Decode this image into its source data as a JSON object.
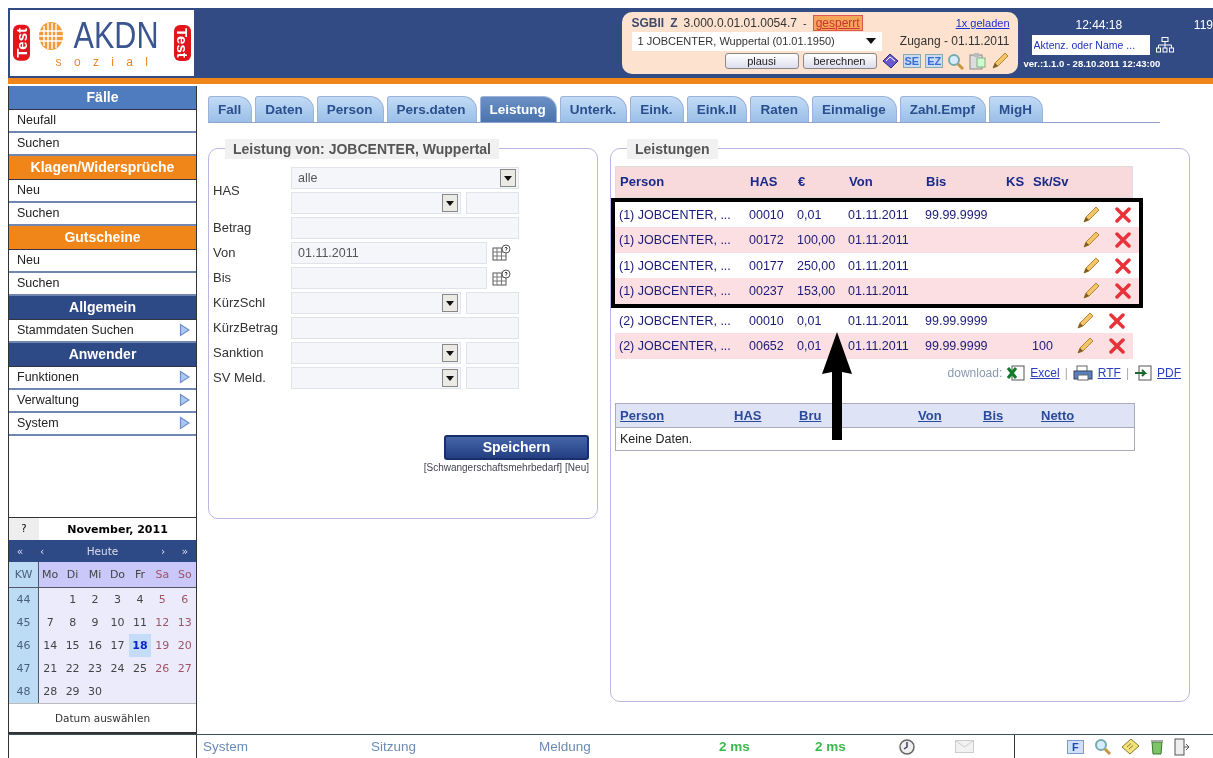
{
  "header": {
    "logo": {
      "badge_left": "Test",
      "brand": "AKDN",
      "subtitle": "s o z i a l",
      "badge_right": "Test"
    },
    "case": {
      "program": "SGBII",
      "mode": "Z",
      "version": "3.000.0.01.01.0054.7",
      "dash": "-",
      "lock_status": "gesperrt",
      "loaded": "1x geladen",
      "person_select": "1 JOBCENTER, Wuppertal (01.01.1950)",
      "access": "Zugang - 01.11.2011",
      "buttons": [
        "plausi",
        "berechnen"
      ],
      "badges": [
        "SE",
        "EZ"
      ]
    },
    "clock": "12:44:18",
    "counter": "119",
    "search": {
      "placeholder": "Aktenz. oder Name ..."
    },
    "version": "ver.:1.1.0 - 28.10.2011 12:43:00"
  },
  "sidebar": {
    "items": [
      {
        "kind": "header",
        "label": "Fälle",
        "color": "#4f7cbf"
      },
      {
        "kind": "item",
        "label": "Neufall",
        "has_submenu": false
      },
      {
        "kind": "item",
        "label": "Suchen",
        "has_submenu": false
      },
      {
        "kind": "header",
        "label": "Klagen/Widersprüche",
        "color": "#f0861a"
      },
      {
        "kind": "item",
        "label": "Neu",
        "has_submenu": false
      },
      {
        "kind": "item",
        "label": "Suchen",
        "has_submenu": false
      },
      {
        "kind": "header",
        "label": "Gutscheine",
        "color": "#f0861a"
      },
      {
        "kind": "item",
        "label": "Neu",
        "has_submenu": false
      },
      {
        "kind": "item",
        "label": "Suchen",
        "has_submenu": false
      },
      {
        "kind": "header",
        "label": "Allgemein",
        "color": "#2e4a86"
      },
      {
        "kind": "item",
        "label": "Stammdaten Suchen",
        "has_submenu": true
      },
      {
        "kind": "header",
        "label": "Anwender",
        "color": "#2e4a86"
      },
      {
        "kind": "item",
        "label": "Funktionen",
        "has_submenu": true
      },
      {
        "kind": "item",
        "label": "Verwaltung",
        "has_submenu": true
      },
      {
        "kind": "item",
        "label": "System",
        "has_submenu": true
      }
    ]
  },
  "calendar": {
    "help": "?",
    "title": "November, 2011",
    "nav": [
      "«",
      "‹",
      "Heute",
      "›",
      "»"
    ],
    "week_label": "KW",
    "weekdays": [
      "Mo",
      "Di",
      "Mi",
      "Do",
      "Fr",
      "Sa",
      "So"
    ],
    "weeks": [
      {
        "kw": "44",
        "days": [
          {
            "day": "1",
            "selected": false
          },
          {
            "day": "2",
            "selected": false
          },
          {
            "day": "3",
            "selected": false
          },
          {
            "day": "4",
            "selected": false
          },
          {
            "day": "5",
            "selected": false
          },
          {
            "day": "6",
            "selected": false
          }
        ]
      },
      {
        "kw": "45",
        "days": [
          {
            "day": "7",
            "selected": false
          },
          {
            "day": "8",
            "selected": false
          },
          {
            "day": "9",
            "selected": false
          },
          {
            "day": "10",
            "selected": false
          },
          {
            "day": "11",
            "selected": false
          },
          {
            "day": "12",
            "selected": false
          },
          {
            "day": "13",
            "selected": false
          }
        ]
      },
      {
        "kw": "46",
        "days": [
          {
            "day": "14",
            "selected": false
          },
          {
            "day": "15",
            "selected": false
          },
          {
            "day": "16",
            "selected": false
          },
          {
            "day": "17",
            "selected": false
          },
          {
            "day": "18",
            "selected": true
          },
          {
            "day": "19",
            "selected": false
          },
          {
            "day": "20",
            "selected": false
          }
        ]
      },
      {
        "kw": "47",
        "days": [
          {
            "day": "21",
            "selected": false
          },
          {
            "day": "22",
            "selected": false
          },
          {
            "day": "23",
            "selected": false
          },
          {
            "day": "24",
            "selected": false
          },
          {
            "day": "25",
            "selected": false
          },
          {
            "day": "26",
            "selected": false
          },
          {
            "day": "27",
            "selected": false
          }
        ]
      },
      {
        "kw": "48",
        "days": [
          {
            "day": "28",
            "selected": false
          },
          {
            "day": "29",
            "selected": false
          },
          {
            "day": "30",
            "selected": false
          }
        ]
      }
    ],
    "footer": "Datum auswählen"
  },
  "tabs": [
    {
      "label": "Fall",
      "selected": false
    },
    {
      "label": "Daten",
      "selected": false
    },
    {
      "label": "Person",
      "selected": false
    },
    {
      "label": "Pers.daten",
      "selected": false
    },
    {
      "label": "Leistung",
      "selected": true
    },
    {
      "label": "Unterk.",
      "selected": false
    },
    {
      "label": "Eink.",
      "selected": false
    },
    {
      "label": "Eink.II",
      "selected": false
    },
    {
      "label": "Raten",
      "selected": false
    },
    {
      "label": "Einmalige",
      "selected": false
    },
    {
      "label": "Zahl.Empf",
      "selected": false
    },
    {
      "label": "MigH",
      "selected": false
    }
  ],
  "form": {
    "legend": "Leistung von: JOBCENTER, Wuppertal",
    "fields": [
      {
        "label": "HAS",
        "kind": "select-double",
        "value": "alle"
      },
      {
        "label": "Betrag",
        "kind": "text"
      },
      {
        "label": "Von",
        "kind": "date",
        "value": "01.11.2011"
      },
      {
        "label": "Bis",
        "kind": "date"
      },
      {
        "label": "KürzSchl",
        "kind": "select"
      },
      {
        "label": "KürzBetrag",
        "kind": "text"
      },
      {
        "label": "Sanktion",
        "kind": "select"
      },
      {
        "label": "SV Meld.",
        "kind": "select"
      }
    ],
    "save_button": "Speichern",
    "links": [
      "[Schwangerschaftsmehrbedarf]",
      "[Neu]"
    ]
  },
  "benefits": {
    "legend": "Leistungen",
    "columns": [
      "Person",
      "HAS",
      "€",
      "Von",
      "Bis",
      "KS",
      "Sk/Sv"
    ],
    "rows": [
      {
        "cells": [
          "(1) JOBCENTER, ...",
          "00010",
          "0,01",
          "01.11.2011",
          "99.99.9999",
          null,
          null
        ],
        "highlighted": true
      },
      {
        "cells": [
          "(1) JOBCENTER, ...",
          "00172",
          "100,00",
          "01.11.2011",
          null,
          null,
          null
        ],
        "highlighted": true
      },
      {
        "cells": [
          "(1) JOBCENTER, ...",
          "00177",
          "250,00",
          "01.11.2011",
          null,
          null,
          null
        ],
        "highlighted": true
      },
      {
        "cells": [
          "(1) JOBCENTER, ...",
          "00237",
          "153,00",
          "01.11.2011",
          null,
          null,
          null
        ],
        "highlighted": true
      },
      {
        "cells": [
          "(2) JOBCENTER, ...",
          "00010",
          "0,01",
          "01.11.2011",
          "99.99.9999",
          null,
          null
        ],
        "highlighted": false
      },
      {
        "cells": [
          "(2) JOBCENTER, ...",
          "00652",
          "0,01",
          "01.11.2011",
          "99.99.9999",
          null,
          "100"
        ],
        "highlighted": false
      }
    ],
    "download": {
      "label": "download:",
      "items": [
        {
          "kind": "link",
          "label": "Excel"
        },
        {
          "kind": "separator",
          "label": "|"
        },
        {
          "kind": "link",
          "label": "RTF"
        },
        {
          "kind": "separator",
          "label": "|"
        },
        {
          "kind": "link",
          "label": "PDF"
        }
      ]
    }
  },
  "payments": {
    "columns": [
      "Person",
      "HAS",
      "Bru",
      "Von",
      "Bis",
      "Netto"
    ],
    "empty_text": "Keine Daten."
  },
  "status_bar": {
    "fields": [
      {
        "label": "System",
        "kind": "caption"
      },
      {
        "label": "Sitzung",
        "kind": "caption"
      },
      {
        "label": "Meldung",
        "kind": "caption"
      },
      {
        "label": "2 ms",
        "kind": "timing"
      },
      {
        "label": "2 ms",
        "kind": "timing"
      }
    ],
    "tool_label": "F"
  }
}
